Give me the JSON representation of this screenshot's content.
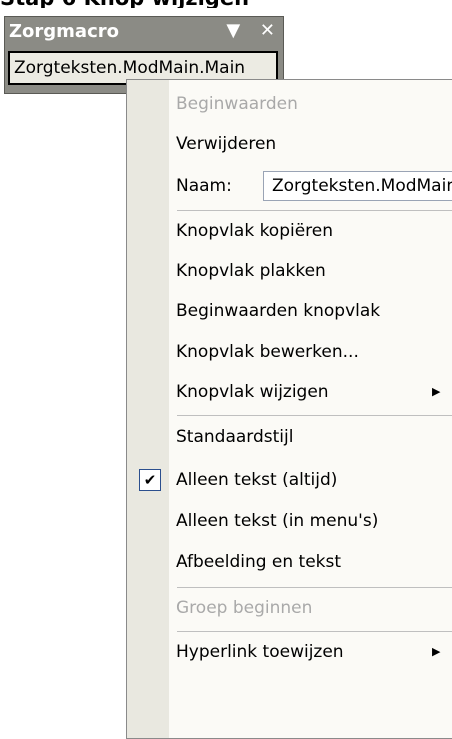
{
  "header_text": "Stap 6 Knop wijzigen",
  "toolbar": {
    "title": "Zorgmacro",
    "dropdown_icon": "▼",
    "close_icon": "✕",
    "button_text": "Zorgteksten.ModMain.Main"
  },
  "menu": {
    "beginwaarden": "Beginwaarden",
    "verwijderen": "Verwijderen",
    "naam_label": "Naam:",
    "naam_value": "Zorgteksten.ModMain.Main",
    "knopvlak_kopieren": "Knopvlak kopiëren",
    "knopvlak_plakken": "Knopvlak plakken",
    "beginwaarden_knopvlak": "Beginwaarden knopvlak",
    "knopvlak_bewerken": "Knopvlak bewerken...",
    "knopvlak_wijzigen": "Knopvlak wijzigen",
    "standaardstijl": "Standaardstijl",
    "alleen_tekst_altijd": "Alleen tekst (altijd)",
    "alleen_tekst_menus": "Alleen tekst (in menu's)",
    "afbeelding_en_tekst": "Afbeelding en tekst",
    "groep_beginnen": "Groep beginnen",
    "hyperlink_toewijzen": "Hyperlink toewijzen"
  }
}
